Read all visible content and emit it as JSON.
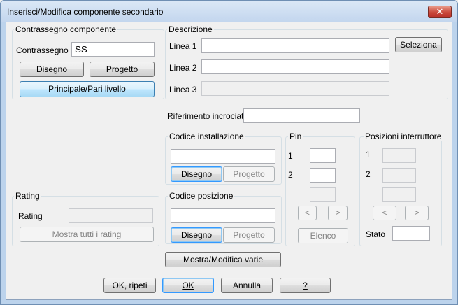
{
  "window": {
    "title": "Inserisci/Modifica componente secondario",
    "close_label": "✕"
  },
  "contrassegno_group": {
    "title": "Contrassegno componente",
    "field_label": "Contrassegno",
    "field_value": "SS",
    "disegno_label": "Disegno",
    "progetto_label": "Progetto",
    "principale_label": "Principale/Pari livello"
  },
  "descrizione_group": {
    "title": "Descrizione",
    "linea1_label": "Linea 1",
    "linea2_label": "Linea 2",
    "linea3_label": "Linea 3",
    "seleziona_label": "Seleziona"
  },
  "riferimento": {
    "label": "Riferimento incrociato"
  },
  "codice_installazione": {
    "title": "Codice installazione",
    "disegno_label": "Disegno",
    "progetto_label": "Progetto"
  },
  "codice_posizione": {
    "title": "Codice posizione",
    "disegno_label": "Disegno",
    "progetto_label": "Progetto"
  },
  "rating_group": {
    "title": "Rating",
    "field_label": "Rating",
    "mostra_label": "Mostra tutti i rating"
  },
  "pin_group": {
    "title": "Pin",
    "label1": "1",
    "label2": "2",
    "prev_label": "<",
    "next_label": ">",
    "elenco_label": "Elenco"
  },
  "posizioni_group": {
    "title": "Posizioni interruttore",
    "label1": "1",
    "label2": "2",
    "prev_label": "<",
    "next_label": ">",
    "stato_label": "Stato"
  },
  "mostra_varie_label": "Mostra/Modifica varie",
  "footer": {
    "ok_ripeti_label": "OK, ripeti",
    "ok_label": "OK",
    "annulla_label": "Annulla",
    "help_label": "?"
  }
}
